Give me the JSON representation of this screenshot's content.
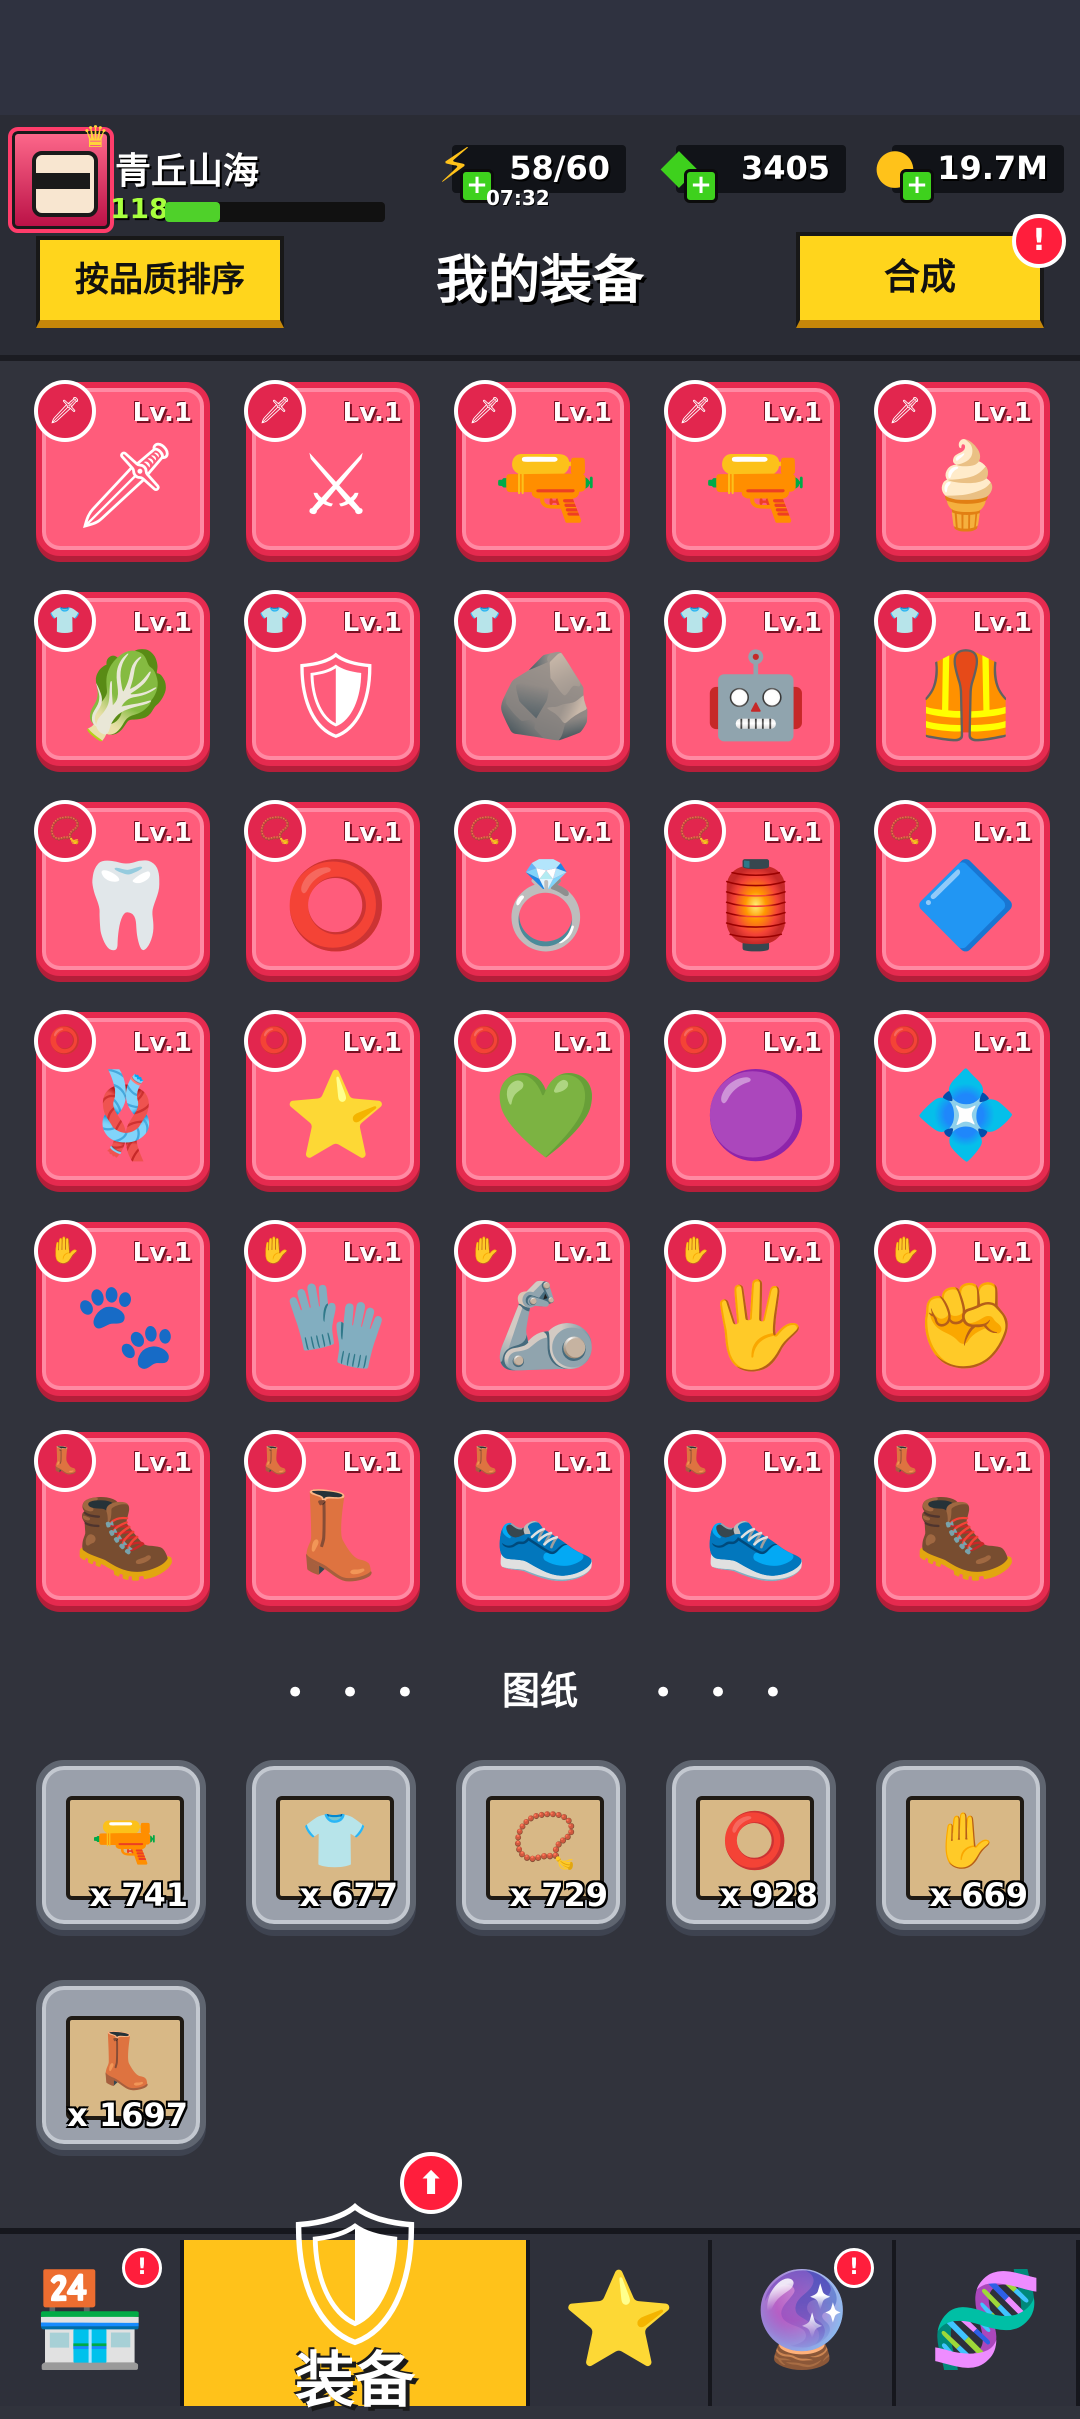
{
  "player": {
    "name": "青丘山海",
    "level": "118",
    "xp_fraction": 0.25
  },
  "resources": {
    "energy": {
      "value": "58/60",
      "timer": "07:32",
      "icon": "lightning-icon"
    },
    "gems": {
      "value": "3405",
      "icon": "green-gem-icon"
    },
    "coins": {
      "value": "19.7M",
      "icon": "gold-coin-icon"
    }
  },
  "header": {
    "sort_label": "按品质排序",
    "title": "我的装备",
    "combine_label": "合成",
    "combine_alert": "!"
  },
  "equipment": [
    {
      "type": "weapon",
      "type_icon": "dagger-icon",
      "icon": "kunai-icon",
      "glyph": "🗡",
      "level": "Lv.1"
    },
    {
      "type": "weapon",
      "type_icon": "dagger-icon",
      "icon": "katana-icon",
      "glyph": "⚔",
      "level": "Lv.1"
    },
    {
      "type": "weapon",
      "type_icon": "dagger-icon",
      "icon": "revolver-icon",
      "glyph": "🔫",
      "level": "Lv.1"
    },
    {
      "type": "weapon",
      "type_icon": "dagger-icon",
      "icon": "shotgun-icon",
      "glyph": "🔫",
      "level": "Lv.1"
    },
    {
      "type": "weapon",
      "type_icon": "dagger-icon",
      "icon": "drill-spear-icon",
      "glyph": "🍦",
      "level": "Lv.1"
    },
    {
      "type": "armor",
      "type_icon": "shirt-icon",
      "icon": "leaf-armor-icon",
      "glyph": "🥬",
      "level": "Lv.1"
    },
    {
      "type": "armor",
      "type_icon": "shirt-icon",
      "icon": "knight-armor-icon",
      "glyph": "🛡",
      "level": "Lv.1"
    },
    {
      "type": "armor",
      "type_icon": "shirt-icon",
      "icon": "stone-armor-icon",
      "glyph": "🪨",
      "level": "Lv.1"
    },
    {
      "type": "armor",
      "type_icon": "shirt-icon",
      "icon": "mech-armor-icon",
      "glyph": "🤖",
      "level": "Lv.1"
    },
    {
      "type": "armor",
      "type_icon": "shirt-icon",
      "icon": "plate-armor-icon",
      "glyph": "🦺",
      "level": "Lv.1"
    },
    {
      "type": "necklace",
      "type_icon": "necklace-icon",
      "icon": "fang-necklace-icon",
      "glyph": "🦷",
      "level": "Lv.1"
    },
    {
      "type": "necklace",
      "type_icon": "necklace-icon",
      "icon": "spiked-collar-icon",
      "glyph": "⭕",
      "level": "Lv.1"
    },
    {
      "type": "necklace",
      "type_icon": "necklace-icon",
      "icon": "gem-necklace-icon",
      "glyph": "💍",
      "level": "Lv.1"
    },
    {
      "type": "necklace",
      "type_icon": "necklace-icon",
      "icon": "lantern-necklace-icon",
      "glyph": "🏮",
      "level": "Lv.1"
    },
    {
      "type": "necklace",
      "type_icon": "necklace-icon",
      "icon": "shield-pendant-icon",
      "glyph": "🔷",
      "level": "Lv.1"
    },
    {
      "type": "belt",
      "type_icon": "belt-icon",
      "icon": "rope-belt-icon",
      "glyph": "🪢",
      "level": "Lv.1"
    },
    {
      "type": "belt",
      "type_icon": "belt-icon",
      "icon": "star-belt-icon",
      "glyph": "⭐",
      "level": "Lv.1"
    },
    {
      "type": "belt",
      "type_icon": "belt-icon",
      "icon": "gem-belt-icon",
      "glyph": "💚",
      "level": "Lv.1"
    },
    {
      "type": "belt",
      "type_icon": "belt-icon",
      "icon": "purple-belt-icon",
      "glyph": "🟣",
      "level": "Lv.1"
    },
    {
      "type": "belt",
      "type_icon": "belt-icon",
      "icon": "crystal-belt-icon",
      "glyph": "💠",
      "level": "Lv.1"
    },
    {
      "type": "gloves",
      "type_icon": "glove-icon",
      "icon": "fur-claw-glove-icon",
      "glyph": "🐾",
      "level": "Lv.1"
    },
    {
      "type": "gloves",
      "type_icon": "glove-icon",
      "icon": "gauntlet-icon",
      "glyph": "🧤",
      "level": "Lv.1"
    },
    {
      "type": "gloves",
      "type_icon": "glove-icon",
      "icon": "mech-glove-icon",
      "glyph": "🦾",
      "level": "Lv.1"
    },
    {
      "type": "gloves",
      "type_icon": "glove-icon",
      "icon": "purple-claw-glove-icon",
      "glyph": "🖐",
      "level": "Lv.1"
    },
    {
      "type": "gloves",
      "type_icon": "glove-icon",
      "icon": "steel-gauntlet-icon",
      "glyph": "✊",
      "level": "Lv.1"
    },
    {
      "type": "boots",
      "type_icon": "boot-icon",
      "icon": "vine-boot-icon",
      "glyph": "🥾",
      "level": "Lv.1"
    },
    {
      "type": "boots",
      "type_icon": "boot-icon",
      "icon": "combat-boot-icon",
      "glyph": "👢",
      "level": "Lv.1"
    },
    {
      "type": "boots",
      "type_icon": "boot-icon",
      "icon": "tech-boot-icon",
      "glyph": "👟",
      "level": "Lv.1"
    },
    {
      "type": "boots",
      "type_icon": "boot-icon",
      "icon": "purple-sneaker-icon",
      "glyph": "👟",
      "level": "Lv.1"
    },
    {
      "type": "boots",
      "type_icon": "boot-icon",
      "icon": "cyber-boot-icon",
      "glyph": "🥾",
      "level": "Lv.1"
    }
  ],
  "blueprints": {
    "title": "图纸",
    "items": [
      {
        "icon": "weapon-blueprint-icon",
        "glyph": "🔫",
        "count": "x 741"
      },
      {
        "icon": "armor-blueprint-icon",
        "glyph": "👕",
        "count": "x 677"
      },
      {
        "icon": "necklace-blueprint-icon",
        "glyph": "📿",
        "count": "x 729"
      },
      {
        "icon": "belt-blueprint-icon",
        "glyph": "⭕",
        "count": "x 928"
      },
      {
        "icon": "glove-blueprint-icon",
        "glyph": "✋",
        "count": "x 669"
      },
      {
        "icon": "boot-blueprint-icon",
        "glyph": "👢",
        "count": "x 1697"
      }
    ]
  },
  "navbar": {
    "items": [
      {
        "name": "shop",
        "icon": "shop-icon",
        "glyph": "🏪",
        "alert": "!"
      },
      {
        "name": "equipment",
        "icon": "equipment-icon",
        "glyph": "🛡",
        "label": "装备",
        "active": true
      },
      {
        "name": "battle",
        "icon": "star-swords-icon",
        "glyph": "⭐"
      },
      {
        "name": "talent",
        "icon": "star-orb-icon",
        "glyph": "🔮",
        "alert": "!"
      },
      {
        "name": "evolution",
        "icon": "dna-capsule-icon",
        "glyph": "🧬"
      }
    ],
    "upgrade_arrow": "⬆"
  },
  "colors": {
    "slot_red": "#ff5c7b",
    "accent_yellow": "#ffd51c",
    "alert_red": "#ff1e3c",
    "bg": "#31333c"
  }
}
